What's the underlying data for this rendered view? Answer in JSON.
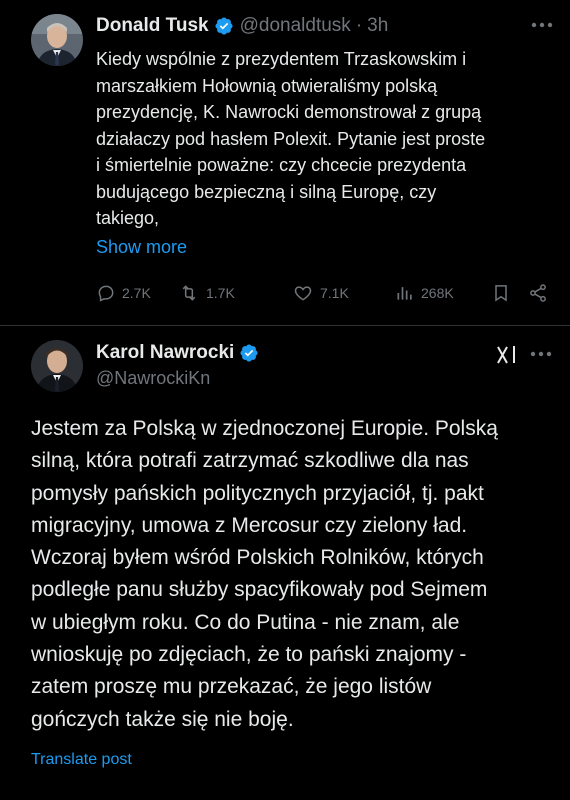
{
  "tweet1": {
    "author_name": "Donald Tusk",
    "handle": "@donaldtusk",
    "separator": "·",
    "time": "3h",
    "body_lines": [
      "Kiedy wspólnie z prezydentem Trzaskowskim i",
      "marszałkiem Hołownią otwieraliśmy polską",
      "prezydencję, K. Nawrocki demonstrował z grupą",
      "działaczy pod hasłem Polexit. Pytanie jest proste",
      "i śmiertelnie poważne: czy chcecie prezydenta",
      "budującego bezpieczną i silną Europę, czy",
      "takiego,"
    ],
    "show_more": "Show more",
    "replies": "2.7K",
    "reposts": "1.7K",
    "likes": "7.1K",
    "views": "268K"
  },
  "tweet2": {
    "author_name": "Karol Nawrocki",
    "handle": "@NawrockiKn",
    "body_lines": [
      "Jestem za Polską w zjednoczonej Europie. Polską",
      "silną, która potrafi zatrzymać szkodliwe dla nas",
      "pomysły pańskich politycznych przyjaciół, tj. pakt",
      "migracyjny, umowa z Mercosur czy zielony ład.",
      "Wczoraj byłem wśród Polskich Rolników, których",
      "podległe panu służby spacyfikowały pod Sejmem",
      "w ubiegłym roku. Co do Putina - nie znam, ale",
      "wnioskuję po zdjęciach, że to pański znajomy -",
      "zatem proszę mu przekazać, że jego listów",
      "gończych także się nie boję."
    ],
    "translate": "Translate post"
  },
  "icons": {
    "verified": "verified-badge-icon",
    "more": "more-options-icon",
    "reply": "reply-icon",
    "repost": "repost-icon",
    "like": "like-icon",
    "views": "views-icon",
    "bookmark": "bookmark-icon",
    "share": "share-icon",
    "grok": "grok-icon"
  },
  "colors": {
    "background": "#000000",
    "text": "#e7e9ea",
    "secondary": "#71767b",
    "accent": "#1d9bf0"
  }
}
